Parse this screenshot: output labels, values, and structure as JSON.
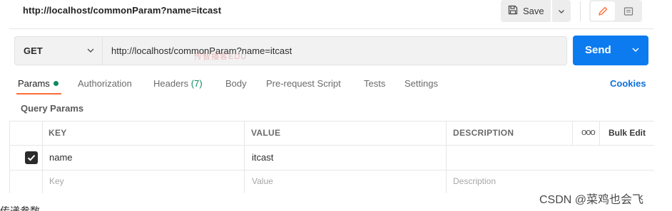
{
  "header": {
    "request_title": "http://localhost/commonParam?name=itcast",
    "save_label": "Save",
    "save_icon": "save-icon",
    "edit_icon": "pencil-icon",
    "doc_icon": "document-icon"
  },
  "request": {
    "method": "GET",
    "url": "http://localhost/commonParam?name=itcast",
    "send_label": "Send"
  },
  "tabs": [
    {
      "label": "Params",
      "active": true,
      "indicator": "green-dot"
    },
    {
      "label": "Authorization"
    },
    {
      "label": "Headers",
      "count": "(7)"
    },
    {
      "label": "Body"
    },
    {
      "label": "Pre-request Script"
    },
    {
      "label": "Tests"
    },
    {
      "label": "Settings"
    }
  ],
  "cookies_label": "Cookies",
  "section_title": "Query Params",
  "table": {
    "columns": [
      "KEY",
      "VALUE",
      "DESCRIPTION"
    ],
    "bulk_edit_label": "Bulk Edit",
    "more_label": "ooo",
    "rows": [
      {
        "checked": true,
        "key": "name",
        "value": "itcast",
        "description": ""
      }
    ],
    "placeholders": {
      "key": "Key",
      "value": "Value",
      "description": "Description"
    }
  },
  "watermarks": {
    "overlay": "传智播客EDU",
    "csdn": "CSDN @菜鸡也会飞"
  },
  "bottom_fragment": "传递参数",
  "colors": {
    "accent": "#ff6c37",
    "send": "#0c7bf0",
    "active_indicator": "#0d8a60",
    "cookies_link": "#0c6fd8"
  }
}
